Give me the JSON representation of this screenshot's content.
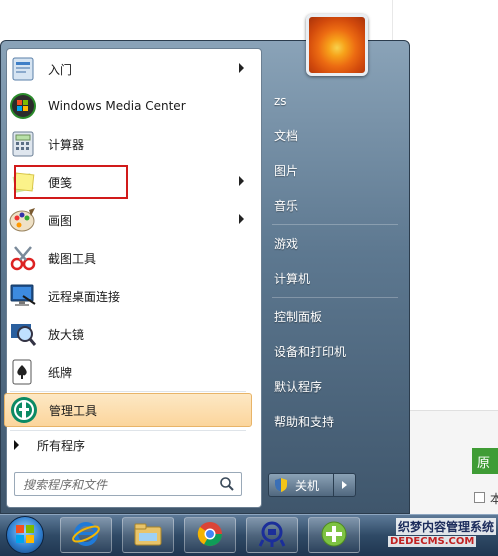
{
  "background": {
    "button_label": "原",
    "checkbox_label": "本"
  },
  "start_menu": {
    "programs": [
      {
        "label": "入门",
        "icon": "getting-started-icon",
        "has_arrow": true
      },
      {
        "label": "Windows Media Center",
        "icon": "media-center-icon",
        "has_arrow": false
      },
      {
        "label": "计算器",
        "icon": "calculator-icon",
        "has_arrow": false
      },
      {
        "label": "便笺",
        "icon": "sticky-notes-icon",
        "has_arrow": true,
        "highlighted": true
      },
      {
        "label": "画图",
        "icon": "paint-icon",
        "has_arrow": true
      },
      {
        "label": "截图工具",
        "icon": "snipping-tool-icon",
        "has_arrow": false
      },
      {
        "label": "远程桌面连接",
        "icon": "remote-desktop-icon",
        "has_arrow": false
      },
      {
        "label": "放大镜",
        "icon": "magnifier-icon",
        "has_arrow": false
      },
      {
        "label": "纸牌",
        "icon": "solitaire-icon",
        "has_arrow": false
      },
      {
        "label": "管理工具",
        "icon": "admin-tools-icon",
        "has_arrow": false,
        "active": true
      }
    ],
    "all_programs": "所有程序",
    "search_placeholder": "搜索程序和文件",
    "right_items": [
      {
        "label": "zs"
      },
      {
        "label": "文档"
      },
      {
        "label": "图片"
      },
      {
        "label": "音乐"
      },
      {
        "label": "游戏"
      },
      {
        "label": "计算机"
      },
      {
        "label": "控制面板"
      },
      {
        "label": "设备和打印机"
      },
      {
        "label": "默认程序"
      },
      {
        "label": "帮助和支持"
      }
    ],
    "shutdown_label": "关机"
  },
  "taskbar": {
    "buttons": [
      {
        "icon": "internet-explorer-icon"
      },
      {
        "icon": "file-explorer-icon"
      },
      {
        "icon": "chrome-icon"
      },
      {
        "icon": "network-icon"
      },
      {
        "icon": "add-app-icon"
      }
    ]
  },
  "watermark": {
    "line1": "织梦内容管理系统",
    "line2": "DEDECMS.COM"
  },
  "colors": {
    "highlight_border": "#d11a1a",
    "active_item": "#fbd59c",
    "menu_frame": "#5d7890"
  }
}
